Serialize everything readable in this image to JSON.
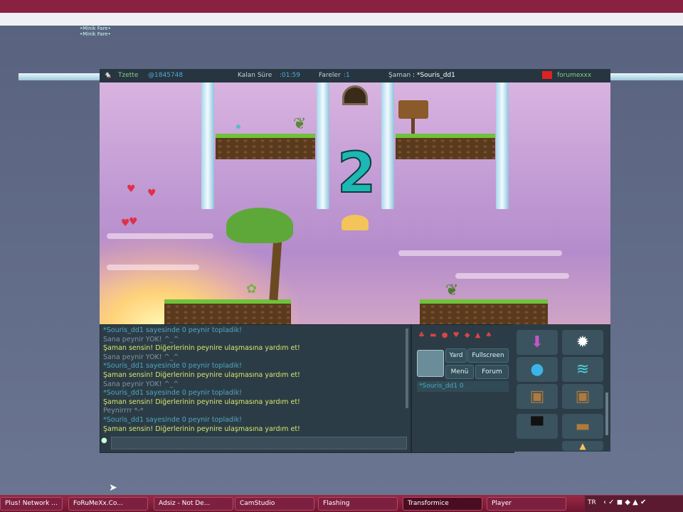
{
  "site": {
    "line1": "•Minik Fare•",
    "line2": "•Minik Fare•"
  },
  "game_topbar": {
    "player_name": "Tzette",
    "player_id": "@1845748",
    "time_label": "Kalan Süre",
    "time_value": ":01:59",
    "mice_label": "Fareler",
    "mice_value": ":1",
    "shaman_label": "Şaman",
    "shaman_value": ": *Souris_dd1",
    "room": "forumexxx"
  },
  "countdown": "2",
  "chat": {
    "lines": [
      {
        "text": "*Souris_dd1 sayesinde 0 peynir topladik!",
        "color": "cyan"
      },
      {
        "text": "Sana peynir YOK! ^_^",
        "color": "gray"
      },
      {
        "text": "Şaman sensin! Diğerlerinin peynire ulaşmasına yardım et!",
        "color": "yellow"
      },
      {
        "text": "Sana peynir YOK! ^_^",
        "color": "gray"
      },
      {
        "text": "*Souris_dd1 sayesinde 0 peynir topladik!",
        "color": "cyan"
      },
      {
        "text": "Şaman sensin! Diğerlerinin peynire ulaşmasına yardım et!",
        "color": "yellow"
      },
      {
        "text": "Sana peynir YOK! ^_^",
        "color": "gray"
      },
      {
        "text": "*Souris_dd1 sayesinde 0 peynir topladik!",
        "color": "cyan"
      },
      {
        "text": "Şaman sensin! Diğerlerinin peynire ulaşmasına yardım et!",
        "color": "yellow"
      },
      {
        "text": "Peynirrrr *-*",
        "color": "gray"
      },
      {
        "text": "*Souris_dd1 sayesinde 0 peynir topladik!",
        "color": "cyan"
      },
      {
        "text": "Şaman sensin! Diğerlerinin peynire ulaşmasına yardım et!",
        "color": "yellow"
      }
    ]
  },
  "menu": {
    "yard": "Yard",
    "fullscreen": "Fullscreen",
    "menu": "Menü",
    "forum": "Forum",
    "player_entry": "*Souris_dd1  0"
  },
  "taskbar": {
    "items": [
      "Plus! Network ...",
      "FoRuMeXx.Co...",
      "Adsiz - Not De...",
      "CamStudio",
      "Flashing",
      "Transformice",
      "Player"
    ],
    "active_index": 5,
    "tray_lang": "TR"
  },
  "colors": {
    "chat_cyan": "#4ea7c0",
    "chat_yellow": "#d6e86c",
    "countdown": "#1db8b3",
    "taskbar": "#8a2140"
  },
  "icons": {
    "shaman_tools": [
      "arrow-down-icon",
      "spirit-icon",
      "balloon-icon",
      "wind-icon",
      "box-small-icon",
      "box-large-icon",
      "anvil-icon",
      "plank-icon",
      "cheese-icon"
    ]
  }
}
